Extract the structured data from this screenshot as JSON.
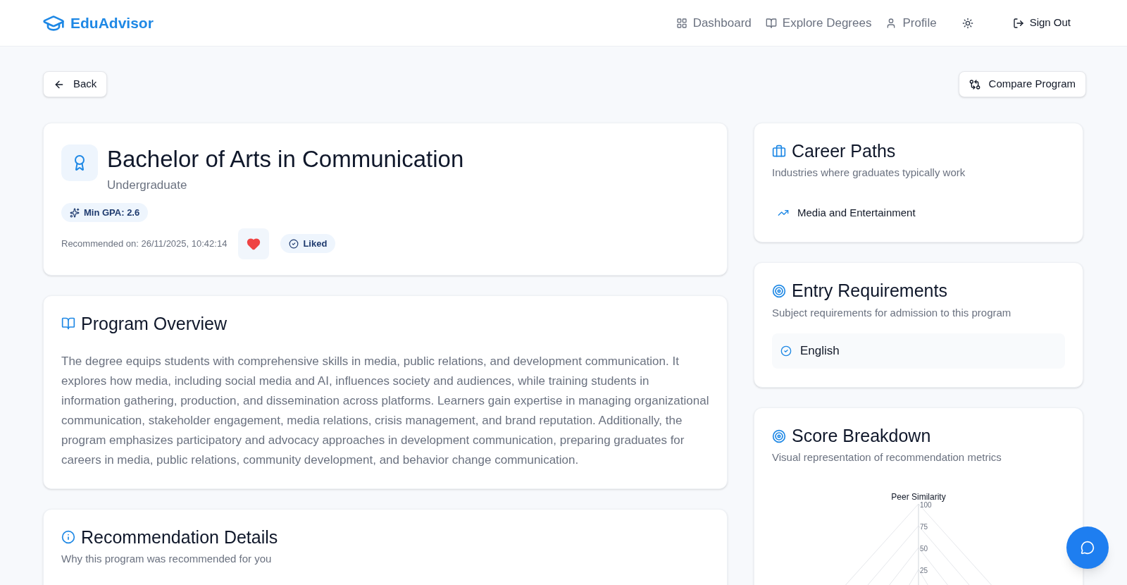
{
  "brand": "EduAdvisor",
  "nav": [
    {
      "kind": "dashboard",
      "label": "Dashboard"
    },
    {
      "kind": "degrees",
      "label": "Explore Degrees"
    },
    {
      "kind": "profile",
      "label": "Profile"
    }
  ],
  "sign_out": "Sign Out",
  "back": "Back",
  "compare": "Compare Program",
  "program": {
    "title": "Bachelor of Arts in Communication",
    "level_name": "Undergraduate",
    "min_gpa": "Min GPA: 2.6",
    "recommended_on": "Recommended on: 26/11/2025, 10:42:14",
    "liked": true,
    "liked_label": "Liked"
  },
  "overview": {
    "title": "Program Overview",
    "text": "The degree equips students with comprehensive skills in media, public relations, and development communication. It explores how media, including social media and AI, influences society and audiences, while training students in information gathering, production, and dissemination across platforms. Learners gain expertise in managing organizational communication, stakeholder engagement, media relations, crisis management, and brand reputation. Additionally, the program emphasizes participatory and advocacy approaches in development communication, preparing graduates for careers in media, public relations, community development, and behavior change communication."
  },
  "recommendation": {
    "title": "Recommendation Details",
    "subtitle": "Why this program was recommended for you"
  },
  "career": {
    "title": "Career Paths",
    "subtitle": "Industries where graduates typically work",
    "items": [
      "Media and Entertainment"
    ]
  },
  "entry": {
    "title": "Entry Requirements",
    "subtitle": "Subject requirements for admission to this program",
    "items": [
      {
        "label": "English",
        "met": true
      }
    ]
  },
  "score": {
    "title": "Score Breakdown",
    "subtitle": "Visual representation of recommendation metrics",
    "axis_label": "Peer Similarity",
    "ticks": [
      "100",
      "75",
      "50",
      "25"
    ]
  }
}
